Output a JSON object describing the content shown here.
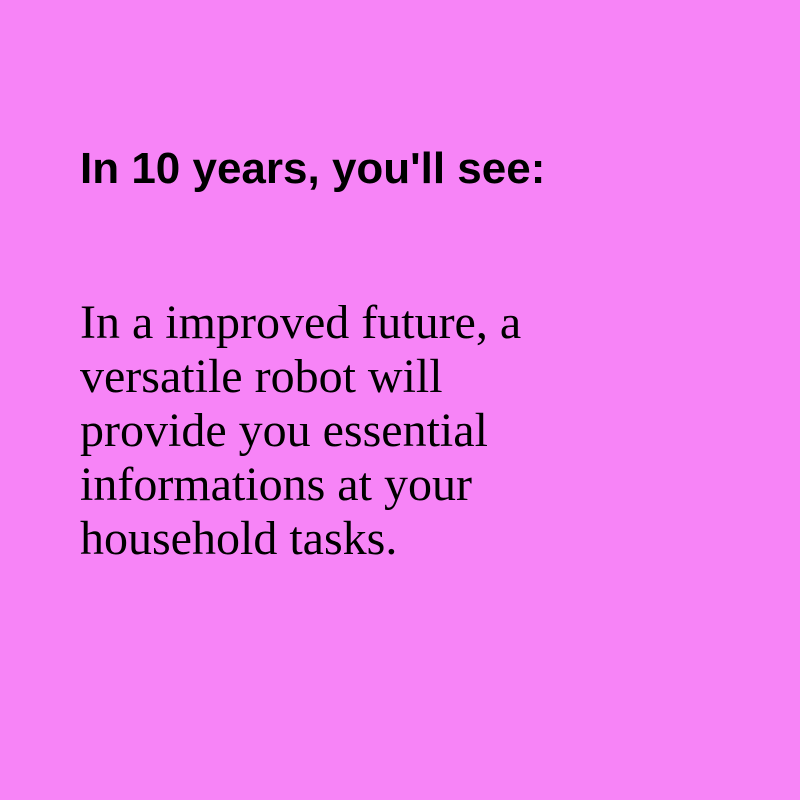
{
  "heading": "In 10 years, you'll see:",
  "body_lines": [
    "In a improved future, a",
    "versatile robot will",
    "provide you essential",
    "informations at your",
    "household tasks."
  ],
  "colors": {
    "background": "#f784f7",
    "text": "#000000"
  }
}
